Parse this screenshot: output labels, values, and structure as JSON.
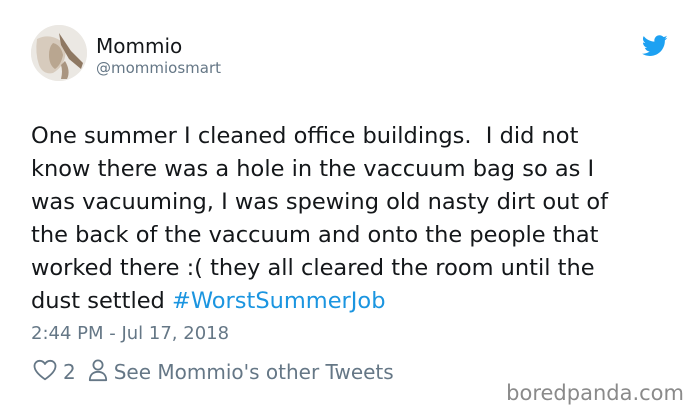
{
  "author": {
    "name": "Mommio",
    "handle": "@mommiosmart"
  },
  "tweet": {
    "lines": [
      "One summer I cleaned office buildings.  I did not",
      "know there was a hole in the vaccuum bag so as I",
      "was vacuuming, I was spewing old nasty dirt out of",
      "the back of the vaccuum and onto the people that",
      "worked there :( they all cleared the room until the"
    ],
    "last_line_prefix": "dust settled ",
    "hashtag": "#WorstSummerJob",
    "timestamp": "2:44 PM - Jul 17, 2018"
  },
  "actions": {
    "like_count": "2",
    "profile_link_label": "See Mommio's other Tweets"
  },
  "watermark": "boredpanda.com",
  "icons": {
    "logo": "twitter-bird-icon",
    "like": "heart-icon",
    "profile": "person-icon"
  },
  "colors": {
    "brand": "#1da1f2",
    "link": "#1b95e0",
    "muted": "#657786",
    "text": "#14171a"
  }
}
